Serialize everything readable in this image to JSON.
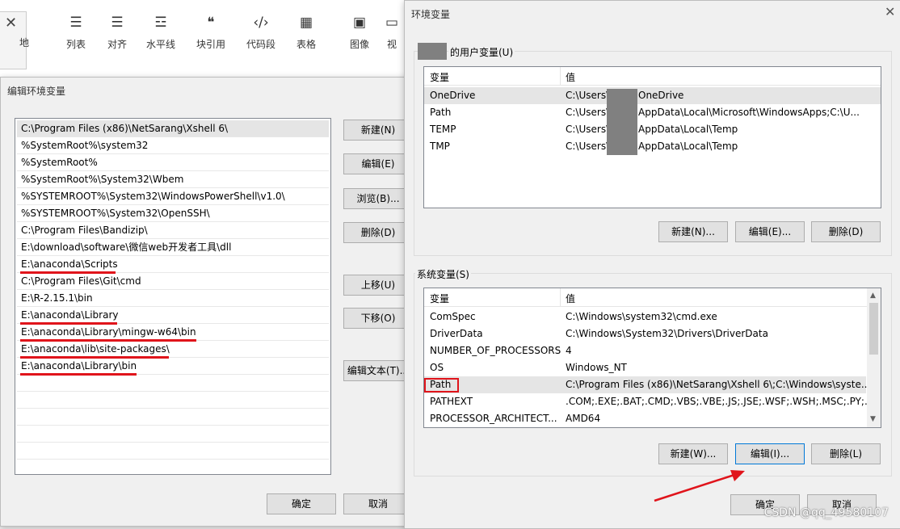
{
  "toolbar": {
    "items": [
      {
        "icon": "bulleted-list-icon",
        "glyph": "☰",
        "label": "列表"
      },
      {
        "icon": "align-icon",
        "glyph": "☰",
        "label": "对齐"
      },
      {
        "icon": "horizontal-line-icon",
        "glyph": "☲",
        "label": "水平线"
      },
      {
        "icon": "quote-icon",
        "glyph": "❝",
        "label": "块引用"
      },
      {
        "icon": "code-icon",
        "glyph": "‹/›",
        "label": "代码段"
      },
      {
        "icon": "table-icon",
        "glyph": "▦",
        "label": "表格"
      },
      {
        "icon": "image-icon",
        "glyph": "▣",
        "label": "图像"
      },
      {
        "icon": "video-icon",
        "glyph": "▭",
        "label": "视"
      }
    ],
    "mini_dialog_label": "地"
  },
  "edit_dialog": {
    "title": "编辑环境变量",
    "close": "✕",
    "entries": [
      "C:\\Program Files (x86)\\NetSarang\\Xshell 6\\",
      "%SystemRoot%\\system32",
      "%SystemRoot%",
      "%SystemRoot%\\System32\\Wbem",
      "%SYSTEMROOT%\\System32\\WindowsPowerShell\\v1.0\\",
      "%SYSTEMROOT%\\System32\\OpenSSH\\",
      "C:\\Program Files\\Bandizip\\",
      "E:\\download\\software\\微信web开发者工具\\dll",
      "E:\\anaconda\\Scripts",
      "C:\\Program Files\\Git\\cmd",
      "E:\\R-2.15.1\\bin",
      "E:\\anaconda\\Library",
      "E:\\anaconda\\Library\\mingw-w64\\bin",
      "E:\\anaconda\\lib\\site-packages\\",
      "E:\\anaconda\\Library\\bin"
    ],
    "buttons": {
      "new": "新建(N)",
      "edit": "编辑(E)",
      "browse": "浏览(B)...",
      "delete": "删除(D)",
      "move_up": "上移(U)",
      "move_down": "下移(O)",
      "edit_text": "编辑文本(T)...",
      "ok": "确定",
      "cancel": "取消"
    }
  },
  "env_window": {
    "title": "环境变量",
    "close": "✕",
    "user_group_label": "的用户变量(U)",
    "col_var": "变量",
    "col_val": "值",
    "user_vars": [
      {
        "name": "OneDrive",
        "value_prefix": "C:\\Users\\",
        "value_suffix": "OneDrive"
      },
      {
        "name": "Path",
        "value_prefix": "C:\\Users\\",
        "value_suffix": "AppData\\Local\\Microsoft\\WindowsApps;C:\\U..."
      },
      {
        "name": "TEMP",
        "value_prefix": "C:\\Users\\",
        "value_suffix": "AppData\\Local\\Temp"
      },
      {
        "name": "TMP",
        "value_prefix": "C:\\Users\\",
        "value_suffix": "AppData\\Local\\Temp"
      }
    ],
    "user_buttons": {
      "new": "新建(N)...",
      "edit": "编辑(E)...",
      "delete": "删除(D)"
    },
    "system_group_label": "系统变量(S)",
    "system_vars": [
      {
        "name": "ComSpec",
        "value": "C:\\Windows\\system32\\cmd.exe"
      },
      {
        "name": "DriverData",
        "value": "C:\\Windows\\System32\\Drivers\\DriverData"
      },
      {
        "name": "NUMBER_OF_PROCESSORS",
        "value": "4"
      },
      {
        "name": "OS",
        "value": "Windows_NT"
      },
      {
        "name": "Path",
        "value": "C:\\Program Files (x86)\\NetSarang\\Xshell 6\\;C:\\Windows\\syste..."
      },
      {
        "name": "PATHEXT",
        "value": ".COM;.EXE;.BAT;.CMD;.VBS;.VBE;.JS;.JSE;.WSF;.WSH;.MSC;.PY;.P..."
      },
      {
        "name": "PROCESSOR_ARCHITECT...",
        "value": "AMD64"
      }
    ],
    "system_buttons": {
      "new": "新建(W)...",
      "edit": "编辑(I)...",
      "delete": "删除(L)"
    },
    "ok": "确定",
    "cancel": "取消"
  },
  "watermark": "CSDN @qq_49580107",
  "colors": {
    "annotation_red": "#e0141b",
    "selection": "#e5e5e5"
  }
}
